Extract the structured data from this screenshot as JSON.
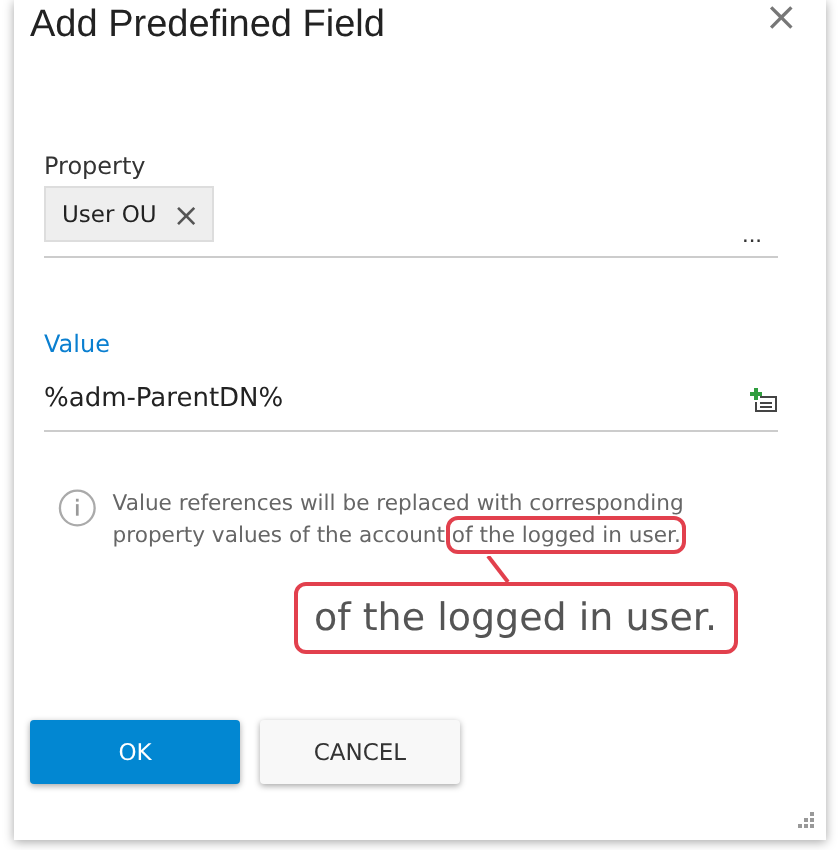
{
  "dialog": {
    "title": "Add Predefined Field",
    "close": "×"
  },
  "property": {
    "label": "Property",
    "chips": [
      {
        "text": "User OU",
        "remove": "×"
      }
    ],
    "browse": "..."
  },
  "value": {
    "label": "Value",
    "value": "%adm-ParentDN%"
  },
  "info": {
    "text": "Value references will be replaced with corresponding property values of the account ",
    "highlight": "of the logged in user."
  },
  "callout": {
    "text": "of the logged in user."
  },
  "buttons": [
    {
      "label": "OK",
      "kind": "primary"
    },
    {
      "label": "CANCEL",
      "kind": "secondary"
    }
  ]
}
